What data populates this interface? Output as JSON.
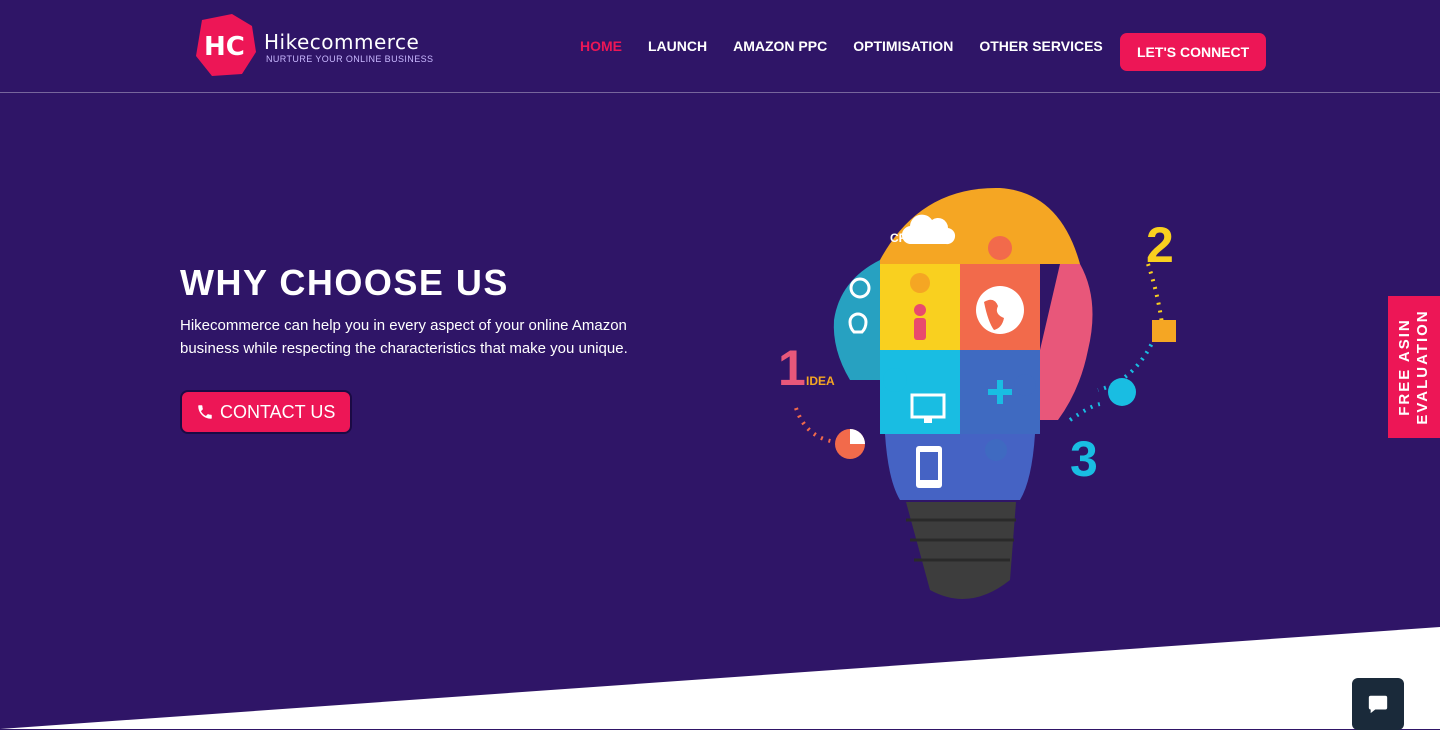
{
  "brand": {
    "logo_mark": "HC",
    "name": "Hikecommerce",
    "tagline": "NURTURE YOUR ONLINE BUSINESS",
    "accent": "#ed1656",
    "background": "#2f1567"
  },
  "nav": {
    "items": [
      {
        "label": "HOME",
        "active": true
      },
      {
        "label": "LAUNCH",
        "active": false
      },
      {
        "label": "AMAZON PPC",
        "active": false
      },
      {
        "label": "OPTIMISATION",
        "active": false
      },
      {
        "label": "OTHER SERVICES",
        "active": false
      }
    ],
    "cta_label": "LET'S CONNECT"
  },
  "hero": {
    "title": "WHY CHOOSE US",
    "description": "Hikecommerce can help you in every aspect of your online Amazon business while respecting the characteristics that make you unique.",
    "contact_label": "CONTACT US",
    "contact_icon": "phone-icon"
  },
  "illustration": {
    "creative_label": "CREATIVE",
    "idea_label": "IDEA",
    "step_numbers": [
      "1",
      "2",
      "3"
    ]
  },
  "side_tab": {
    "label": "FREE ASIN EVALUATION"
  },
  "chat": {
    "icon": "chat-icon"
  }
}
